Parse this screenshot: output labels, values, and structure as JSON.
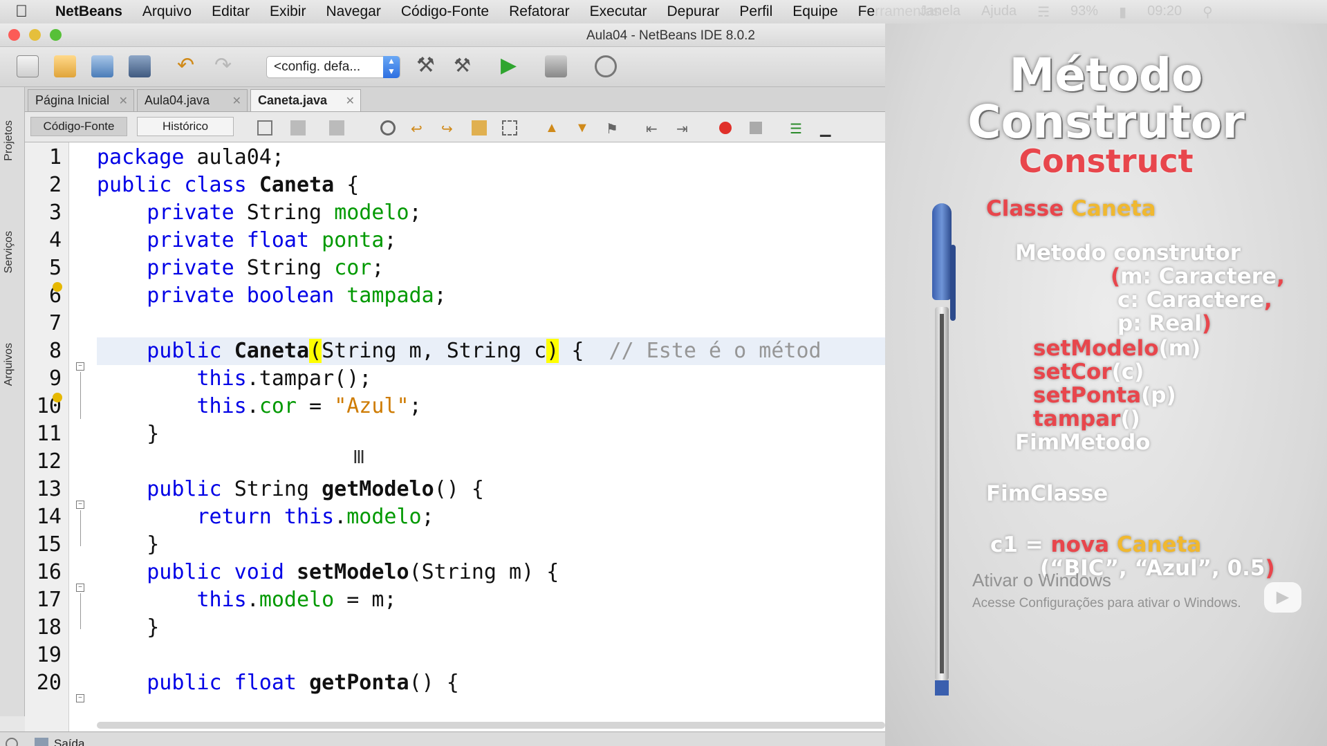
{
  "menubar": {
    "app": "NetBeans",
    "items": [
      "Arquivo",
      "Editar",
      "Exibir",
      "Navegar",
      "Código-Fonte",
      "Refatorar",
      "Executar",
      "Depurar",
      "Perfil",
      "Equipe",
      "Fe"
    ],
    "faded": [
      "rramentas",
      "Janela",
      "Ajuda"
    ],
    "battery": "93%",
    "clock": "09:20"
  },
  "window": {
    "title": "Aula04 - NetBeans IDE 8.0.2",
    "config": "<config. defa...",
    "side_tabs": [
      "Projetos",
      "Serviços",
      "Arquivos"
    ],
    "tabs": [
      {
        "label": "Página Inicial",
        "active": false
      },
      {
        "label": "Aula04.java",
        "active": false
      },
      {
        "label": "Caneta.java",
        "active": true
      }
    ],
    "editor_buttons": {
      "source": "Código-Fonte",
      "history": "Histórico"
    },
    "status_label": "Saída"
  },
  "code": {
    "line_numbers": [
      "1",
      "2",
      "3",
      "4",
      "5",
      "6",
      "7",
      "8",
      "9",
      "10",
      "11",
      "12",
      "13",
      "14",
      "15",
      "16",
      "17",
      "18",
      "19",
      "20"
    ],
    "package_kw": "package",
    "package_name": " aula04;",
    "l2": {
      "kw": "public class ",
      "name": "Caneta",
      "rest": " {"
    },
    "l3": {
      "kw": "private ",
      "type": "String ",
      "field": "modelo",
      "end": ";"
    },
    "l4": {
      "kw": "private float ",
      "field": "ponta",
      "end": ";"
    },
    "l5": {
      "kw": "private ",
      "type": "String ",
      "field": "cor",
      "end": ";"
    },
    "l6": {
      "kw": "private boolean ",
      "field": "tampada",
      "end": ";"
    },
    "l8": {
      "kw": "public ",
      "name": "Caneta",
      "open": "(",
      "params": "String m, String c",
      "close": ")",
      "rest": " {  ",
      "comment": "// Este é o métod"
    },
    "l9": {
      "kw": "this",
      "rest": ".tampar();"
    },
    "l10": {
      "kw": "this",
      "dot": ".",
      "field": "cor",
      "eq": " = ",
      "str": "\"Azul\"",
      "end": ";"
    },
    "l11": "}",
    "l13": {
      "kw": "public ",
      "type": "String ",
      "name": "getModelo",
      "rest": "() {"
    },
    "l14": {
      "kw": "return this",
      "dot": ".",
      "field": "modelo",
      "end": ";"
    },
    "l15": "}",
    "l16": {
      "kw": "public void ",
      "name": "setModelo",
      "rest": "(String m) {"
    },
    "l17": {
      "kw": "this",
      "dot": ".",
      "field": "modelo",
      "rest": " = m;"
    },
    "l18": "}",
    "l20": {
      "kw": "public float ",
      "name": "getPonta",
      "rest": "() {"
    }
  },
  "overlay": {
    "title1": "Método",
    "title2": "Construtor",
    "subtitle": "Construct",
    "classe_kw": "Classe",
    "classe_name": "Caneta",
    "metodo": "Metodo construtor",
    "param_open": "(",
    "param1": "m: Caractere",
    "comma": ",",
    "param2": "c: Caractere",
    "param3": "p: Real",
    "param_close": ")",
    "set_modelo": "setModelo",
    "set_modelo_arg": "(m)",
    "set_cor": "setCor",
    "set_cor_arg": "(c)",
    "set_ponta": "setPonta",
    "set_ponta_arg": "(p)",
    "tampar": "tampar",
    "tampar_arg": "()",
    "fim_metodo": "FimMetodo",
    "fim_classe": "FimClasse",
    "inst_var": "c1 = ",
    "inst_kw": "nova ",
    "inst_cls": "Caneta",
    "inst_args": "(“BIC”, “Azul”, 0.5",
    "watermark_title": "Ativar o Windows",
    "watermark_sub": "Acesse Configurações para ativar o Windows."
  },
  "colors": {
    "keyword": "#0000e6",
    "field": "#009900",
    "string": "#ce7b00",
    "comment": "#969696",
    "overlay_red": "#e8464c",
    "overlay_yellow": "#f0b830"
  }
}
